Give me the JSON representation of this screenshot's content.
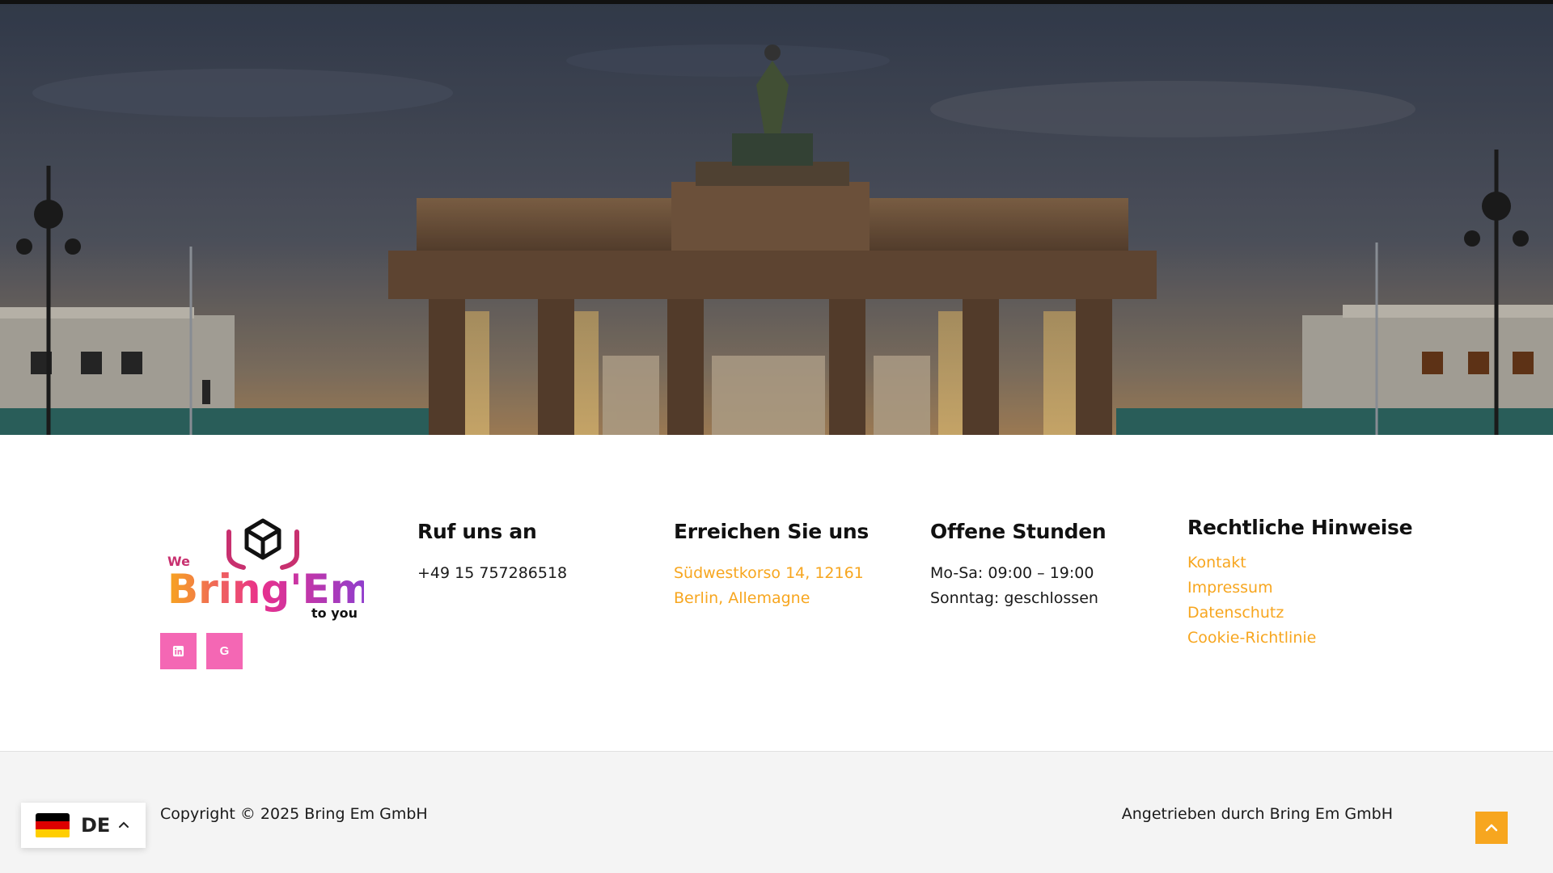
{
  "hero": {
    "scene": "brandenburg-gate-dusk"
  },
  "brand": {
    "logo_we": "We",
    "logo_main": "Bring'Em",
    "logo_sub": "to you",
    "colors": {
      "pink": "#f467b4",
      "orange": "#f7a61f",
      "purple": "#8a3fd1"
    }
  },
  "socials": [
    {
      "icon": "linkedin-icon"
    },
    {
      "icon": "google-icon",
      "glyph": "G"
    }
  ],
  "columns": {
    "call": {
      "title": "Ruf uns an",
      "phone": "+49 15 757286518"
    },
    "reach": {
      "title": "Erreichen Sie uns",
      "address_line1": "Südwestkorso 14, 12161",
      "address_line2": "Berlin, Allemagne"
    },
    "hours": {
      "title": "Offene Stunden",
      "line1": "Mo-Sa: 09:00 – 19:00",
      "line2": "Sonntag: geschlossen"
    },
    "legal": {
      "title": "Rechtliche Hinweise",
      "links": [
        "Kontakt",
        "Impressum",
        "Datenschutz",
        "Cookie-Richtlinie"
      ]
    }
  },
  "bottom": {
    "copyright": "Copyright © 2025 Bring Em GmbH",
    "powered": "Angetrieben durch Bring Em GmbH"
  },
  "language": {
    "code": "DE",
    "flag_colors": [
      "#000000",
      "#dd0000",
      "#ffce00"
    ]
  }
}
